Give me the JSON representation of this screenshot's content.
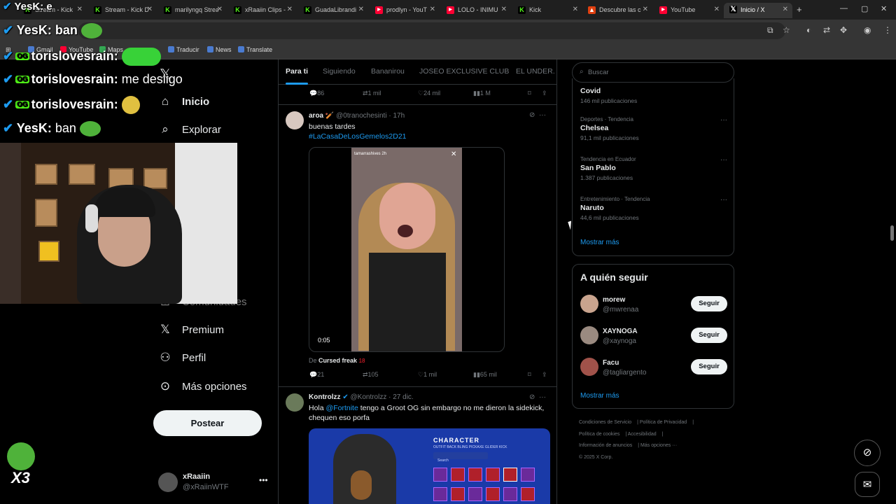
{
  "browser": {
    "tabs": [
      {
        "label": "Stream - Kick",
        "favicon": "kick"
      },
      {
        "label": "Stream - Kick D",
        "favicon": "kick"
      },
      {
        "label": "marilyngq Strea",
        "favicon": "kick"
      },
      {
        "label": "xRaaiin Clips -",
        "favicon": "kick"
      },
      {
        "label": "GuadaLibrandi",
        "favicon": "kick"
      },
      {
        "label": "prodlyn - YouT",
        "favicon": "youtube"
      },
      {
        "label": "LOLO - INIMU",
        "favicon": "youtube"
      },
      {
        "label": "Kick",
        "favicon": "kick"
      },
      {
        "label": "Descubre las c",
        "favicon": "brave"
      },
      {
        "label": "YouTube",
        "favicon": "youtube"
      },
      {
        "label": "Inicio / X",
        "favicon": "x"
      }
    ],
    "new_tab": "+",
    "window_controls": [
      "—",
      "▢",
      "✕"
    ],
    "bookmarks": [
      "Gmail",
      "YouTube",
      "Maps",
      "Traducir",
      "News",
      "Translate"
    ]
  },
  "overlay": {
    "chat": [
      {
        "user": "YesK",
        "message": "e"
      },
      {
        "user": "YesK",
        "message": "ban"
      },
      {
        "user": "torislovesrain",
        "message": ""
      },
      {
        "user": "torislovesrain",
        "message": "me desligo"
      },
      {
        "user": "torislovesrain",
        "message": ""
      },
      {
        "user": "YesK",
        "message": "ban"
      }
    ],
    "multiplier": "X3"
  },
  "nav": {
    "items": [
      {
        "label": "Inicio",
        "icon": "home-icon"
      },
      {
        "label": "Explorar",
        "icon": "search-icon"
      },
      {
        "label": "Premium",
        "icon": "x-logo-icon"
      },
      {
        "label": "Perfil",
        "icon": "person-icon"
      },
      {
        "label": "Más opciones",
        "icon": "more-circle-icon"
      }
    ],
    "partial_labels": [
      "s",
      "Comunidades"
    ],
    "post_button": "Postear",
    "account": {
      "name": "xRaaiin",
      "handle": "@xRaiinWTF"
    }
  },
  "feed": {
    "tabs": [
      "Para ti",
      "Siguiendo",
      "Bananirou",
      "JOSEO EXCLUSIVE CLUB",
      "EL UNDER."
    ],
    "prev_actions": {
      "replies": "86",
      "reposts": "1 mil",
      "likes": "24 mil",
      "views": "1 M"
    },
    "tweets": [
      {
        "name": "aroa",
        "handle": "@0tranochesinti",
        "time": "17h",
        "text": "buenas tardes",
        "hashtag": "#LaCasaDeLosGemelos2D21",
        "video_duration": "0:05",
        "video_overlay_user": "tamarrashives  2h",
        "source_prefix": "De",
        "source": "Cursed freak",
        "source_badge": "18",
        "replies": "21",
        "reposts": "105",
        "likes": "1 mil",
        "views": "65 mil"
      },
      {
        "name": "Kontrolzz",
        "handle": "@Kontrolzz",
        "time": "27 dic.",
        "text_pre": "Hola",
        "mention": "@Fortnite",
        "text_post": "tengo a Groot OG sin embargo no me dieron la sidekick, chequen eso porfa",
        "image_title": "CHARACTER",
        "image_tabs": "OUTFIT   BACK BLING   PICKAXE   GLIDER   KICK",
        "image_search": "Search"
      }
    ]
  },
  "sidebar": {
    "search_placeholder": "Buscar",
    "trends": [
      {
        "context": "",
        "title": "Covid",
        "count": "146 mil publicaciones"
      },
      {
        "context": "Deportes · Tendencia",
        "title": "Chelsea",
        "count": "91,1 mil publicaciones"
      },
      {
        "context": "Tendencia en Ecuador",
        "title": "San Pablo",
        "count": "1.387 publicaciones"
      },
      {
        "context": "Entretenimiento · Tendencia",
        "title": "Naruto",
        "count": "44,6 mil publicaciones"
      }
    ],
    "trends_show_more": "Mostrar más",
    "who_to_follow_title": "A quién seguir",
    "who_to_follow": [
      {
        "name": "morew",
        "handle": "@mwrenaa",
        "button": "Seguir"
      },
      {
        "name": "XAYNOGA",
        "handle": "@xaynoga",
        "button": "Seguir"
      },
      {
        "name": "Facu",
        "handle": "@tagliargento",
        "button": "Seguir"
      }
    ],
    "who_show_more": "Mostrar más",
    "footer": {
      "links": [
        "Condiciones de Servicio",
        "Política de Privacidad",
        "Política de cookies",
        "Accesibilidad",
        "Información de anuncios",
        "Más opciones ···"
      ],
      "copyright": "© 2025 X Corp."
    }
  },
  "colors": {
    "accent": "#1d9bf0",
    "background": "#000000",
    "kick_green": "#53fc18"
  }
}
